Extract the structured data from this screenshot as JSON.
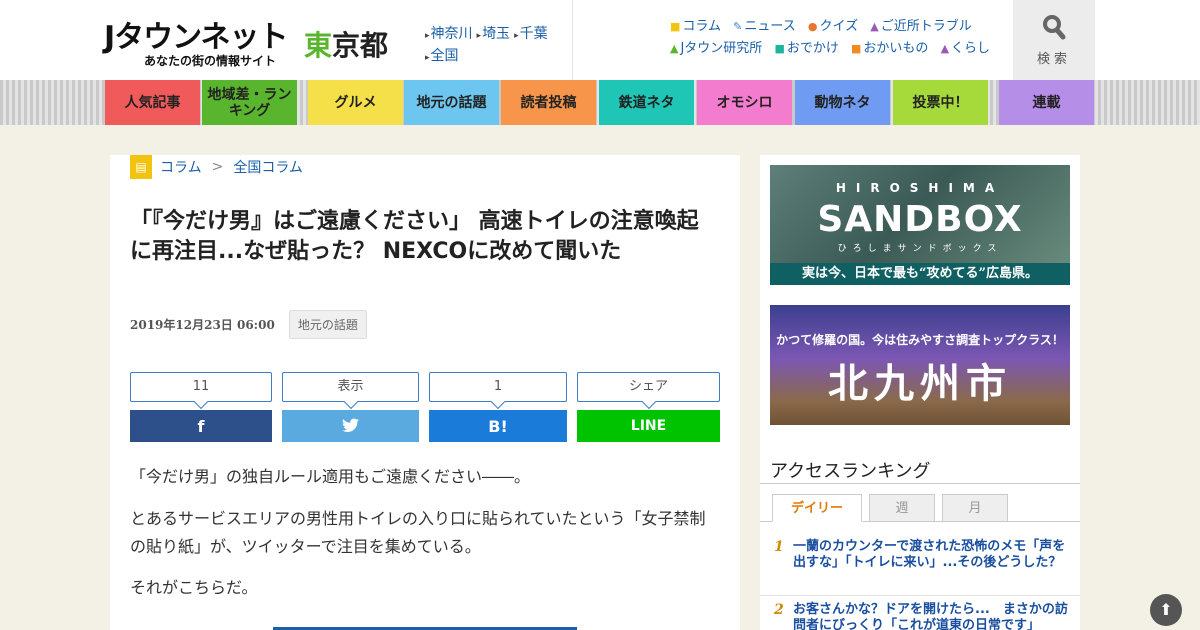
{
  "header": {
    "logo_main": "Jタウンネット",
    "logo_sub": "あなたの街の情報サイト",
    "pref_a": "東",
    "pref_b": "京都",
    "regions": [
      "神奈川",
      "埼玉",
      "千葉",
      "全国"
    ],
    "quick_links": [
      {
        "label": "コラム",
        "icon": "note-icon",
        "color": "#f2c40f"
      },
      {
        "label": "ニュース",
        "icon": "pencil-icon",
        "color": "#3f7dc4"
      },
      {
        "label": "クイズ",
        "icon": "quiz-icon",
        "color": "#e8772e"
      },
      {
        "label": "ご近所トラブル",
        "icon": "house-icon",
        "color": "#9b59b6"
      },
      {
        "label": "Jタウン研究所",
        "icon": "flask-icon",
        "color": "#59b52e"
      },
      {
        "label": "おでかけ",
        "icon": "car-icon",
        "color": "#1fb59a"
      },
      {
        "label": "おかいもの",
        "icon": "bag-icon",
        "color": "#f08a24"
      },
      {
        "label": "くらし",
        "icon": "home-icon",
        "color": "#9b59b6"
      }
    ],
    "search_label": "検索"
  },
  "nav": [
    {
      "label": "人気記事",
      "color": "#f15a5a"
    },
    {
      "label": "地域差・ランキング",
      "color": "#59b52e"
    },
    {
      "label": "グルメ",
      "color": "#f5e04a"
    },
    {
      "label": "地元の話題",
      "color": "#6cc6ef"
    },
    {
      "label": "読者投稿",
      "color": "#f7964a"
    },
    {
      "label": "鉄道ネタ",
      "color": "#1fc6b5"
    },
    {
      "label": "オモシロ",
      "color": "#f47ccf"
    },
    {
      "label": "動物ネタ",
      "color": "#6f9cf2"
    },
    {
      "label": "投票中！",
      "color": "#a5da3a"
    },
    {
      "label": "連載",
      "color": "#b58ee8"
    }
  ],
  "article": {
    "breadcrumb": [
      "コラム",
      ">",
      "全国コラム"
    ],
    "title": "「『今だけ男』はご遠慮ください」 高速トイレの注意喚起に再注目...なぜ貼った？ NEXCOに改めて聞いた",
    "date": "2019年12月23日 06:00",
    "tag": "地元の話題",
    "share": [
      {
        "count": "11",
        "label": "f",
        "color": "#2d4f8a",
        "icon": "facebook-icon"
      },
      {
        "count": "表示",
        "label": "twitter",
        "color": "#5aaadf",
        "icon": "twitter-icon"
      },
      {
        "count": "1",
        "label": "B!",
        "color": "#1b7bd8",
        "icon": "hatena-icon"
      },
      {
        "count": "シェア",
        "label": "LINE",
        "color": "#00c300",
        "icon": "line-icon"
      }
    ],
    "paragraphs": [
      "「今だけ男」の独自ルール適用もご遠慮ください――。",
      "とあるサービスエリアの男性用トイレの入り口に貼られていたという「女子禁制の貼り紙」が、ツイッターで注目を集めている。",
      "それがこちらだ。"
    ]
  },
  "sidebar": {
    "banner1": {
      "top": "HIROSHIMA",
      "main": "SANDBOX",
      "sub": "ひろしまサンドボックス",
      "bar": "実は今、日本で最も“攻めてる”広島県。"
    },
    "banner2": {
      "top": "かつて修羅の国。今は住みやすさ調査トップクラス！",
      "main": "北九州市"
    },
    "ranking_title": "アクセスランキング",
    "tabs": [
      "デイリー",
      "週",
      "月"
    ],
    "ranking": [
      {
        "num": "1",
        "text": "一蘭のカウンターで渡された恐怖のメモ「声を出すな」「トイレに来い」...その後どうした？"
      },
      {
        "num": "2",
        "text": "お客さんかな？ドアを開けたら...　まさかの訪問者にびっくり「これが道東の日常です」"
      }
    ]
  }
}
